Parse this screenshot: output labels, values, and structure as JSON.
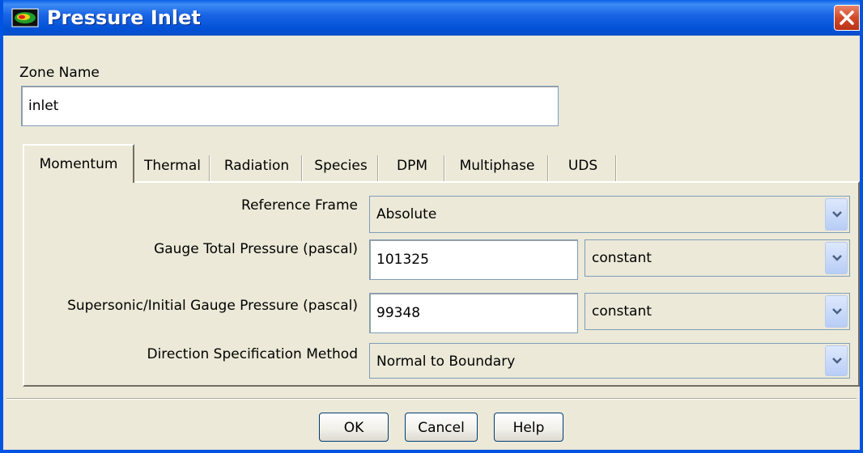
{
  "window": {
    "title": "Pressure Inlet",
    "icon": "fluent-app-icon",
    "close_icon": "close-icon"
  },
  "zone": {
    "label": "Zone Name",
    "value": "inlet"
  },
  "tabs": [
    {
      "label": "Momentum",
      "active": true
    },
    {
      "label": "Thermal",
      "active": false
    },
    {
      "label": "Radiation",
      "active": false
    },
    {
      "label": "Species",
      "active": false
    },
    {
      "label": "DPM",
      "active": false
    },
    {
      "label": "Multiphase",
      "active": false
    },
    {
      "label": "UDS",
      "active": false
    }
  ],
  "momentum": {
    "reference_frame": {
      "label": "Reference Frame",
      "value": "Absolute"
    },
    "gauge_total_pressure": {
      "label": "Gauge Total Pressure (pascal)",
      "value": "101325",
      "profile": "constant"
    },
    "supersonic_pressure": {
      "label": "Supersonic/Initial Gauge Pressure (pascal)",
      "value": "99348",
      "profile": "constant"
    },
    "direction_method": {
      "label": "Direction Specification Method",
      "value": "Normal to Boundary"
    }
  },
  "buttons": {
    "ok": "OK",
    "cancel": "Cancel",
    "help": "Help"
  },
  "colors": {
    "titlebar": "#0251d6",
    "dialog_bg": "#ece9d8",
    "close_button": "#d24a28"
  }
}
